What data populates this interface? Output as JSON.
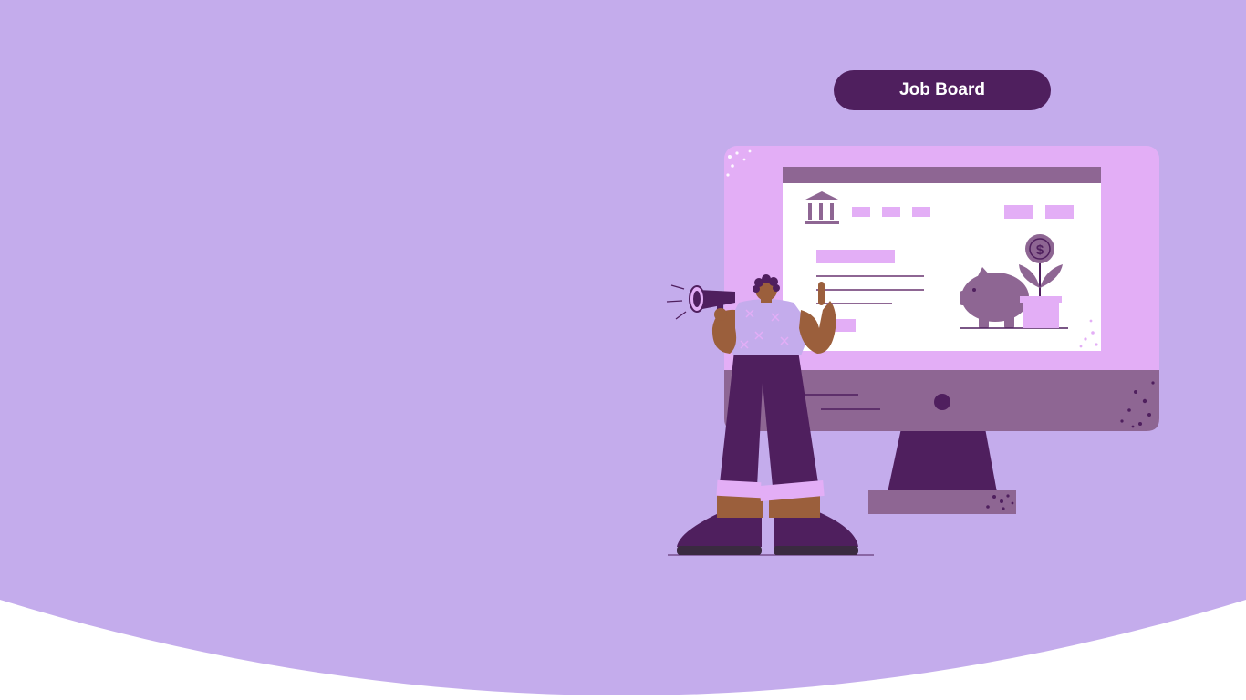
{
  "hero": {
    "cta_label": "Job Board",
    "illustration_icon": "megaphone-person-monitor-illustration"
  },
  "colors": {
    "hero_background": "#c4acec",
    "page_background": "#ffffff",
    "button_background": "#4f1f5e",
    "button_text": "#ffffff",
    "monitor_frame": "#e3aef6",
    "monitor_bezel": "#8e6693",
    "dark_purple": "#4f1f5e",
    "screen_white": "#ffffff",
    "skin": "#9b5f3c"
  },
  "screen": {
    "logo_icon": "bank-building-icon",
    "piggy_icon": "piggy-bank-icon",
    "coin_symbol": "$"
  }
}
